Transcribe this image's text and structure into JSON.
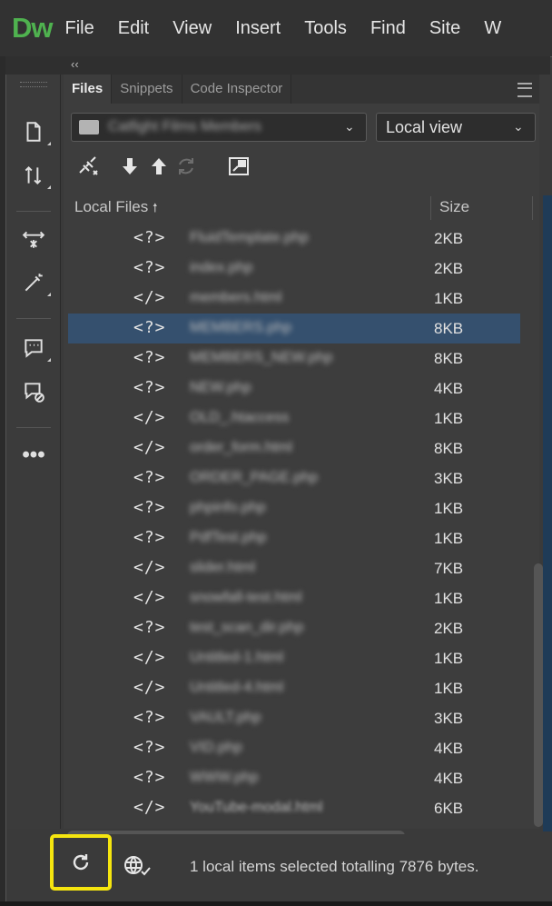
{
  "app": {
    "logo": "Dw"
  },
  "menu": [
    "File",
    "Edit",
    "View",
    "Insert",
    "Tools",
    "Find",
    "Site",
    "W"
  ],
  "panel": {
    "collapse_glyph": "‹‹",
    "tabs": [
      {
        "label": "Files",
        "active": true
      },
      {
        "label": "Snippets",
        "active": false
      },
      {
        "label": "Code Inspector",
        "active": false
      }
    ],
    "site_select": {
      "value": "Catfight Films Members"
    },
    "view_select": {
      "value": "Local view"
    },
    "columns": {
      "name": "Local Files",
      "size": "Size",
      "sort_glyph": "🠕"
    },
    "files": [
      {
        "icon": "<?>",
        "name": "FluidTemplate.php",
        "size": "2KB"
      },
      {
        "icon": "<?>",
        "name": "index.php",
        "size": "2KB"
      },
      {
        "icon": "</>",
        "name": "members.html",
        "size": "1KB"
      },
      {
        "icon": "<?>",
        "name": "MEMBERS.php",
        "size": "8KB",
        "selected": true
      },
      {
        "icon": "<?>",
        "name": "MEMBERS_NEW.php",
        "size": "8KB"
      },
      {
        "icon": "<?>",
        "name": "NEW.php",
        "size": "4KB"
      },
      {
        "icon": "</>",
        "name": "OLD_.htaccess",
        "size": "1KB"
      },
      {
        "icon": "</>",
        "name": "order_form.html",
        "size": "8KB"
      },
      {
        "icon": "<?>",
        "name": "ORDER_PAGE.php",
        "size": "3KB"
      },
      {
        "icon": "<?>",
        "name": "phpinfo.php",
        "size": "1KB"
      },
      {
        "icon": "<?>",
        "name": "PdfTest.php",
        "size": "1KB"
      },
      {
        "icon": "</>",
        "name": "slider.html",
        "size": "7KB"
      },
      {
        "icon": "</>",
        "name": "snowfall-test.html",
        "size": "1KB"
      },
      {
        "icon": "<?>",
        "name": "test_scan_dir.php",
        "size": "2KB"
      },
      {
        "icon": "</>",
        "name": "Untitled-1.html",
        "size": "1KB"
      },
      {
        "icon": "</>",
        "name": "Untitled-4.html",
        "size": "1KB"
      },
      {
        "icon": "<?>",
        "name": "VAULT.php",
        "size": "3KB"
      },
      {
        "icon": "<?>",
        "name": "VID.php",
        "size": "4KB"
      },
      {
        "icon": "<?>",
        "name": "WWW.php",
        "size": "4KB"
      },
      {
        "icon": "</>",
        "name": "YouTube-modal.html",
        "size": "6KB"
      }
    ]
  },
  "toolbar_tools": [
    "file-icon",
    "sort-arrows-icon",
    "expand-icon",
    "wand-icon",
    "comment-icon",
    "comment-remove-icon",
    "more-icon"
  ],
  "status": {
    "text": "1 local items selected totalling 7876 bytes."
  },
  "colors": {
    "accent_logo": "#4fb24f",
    "selection": "#35506e",
    "highlight_box": "#f5e50f"
  }
}
